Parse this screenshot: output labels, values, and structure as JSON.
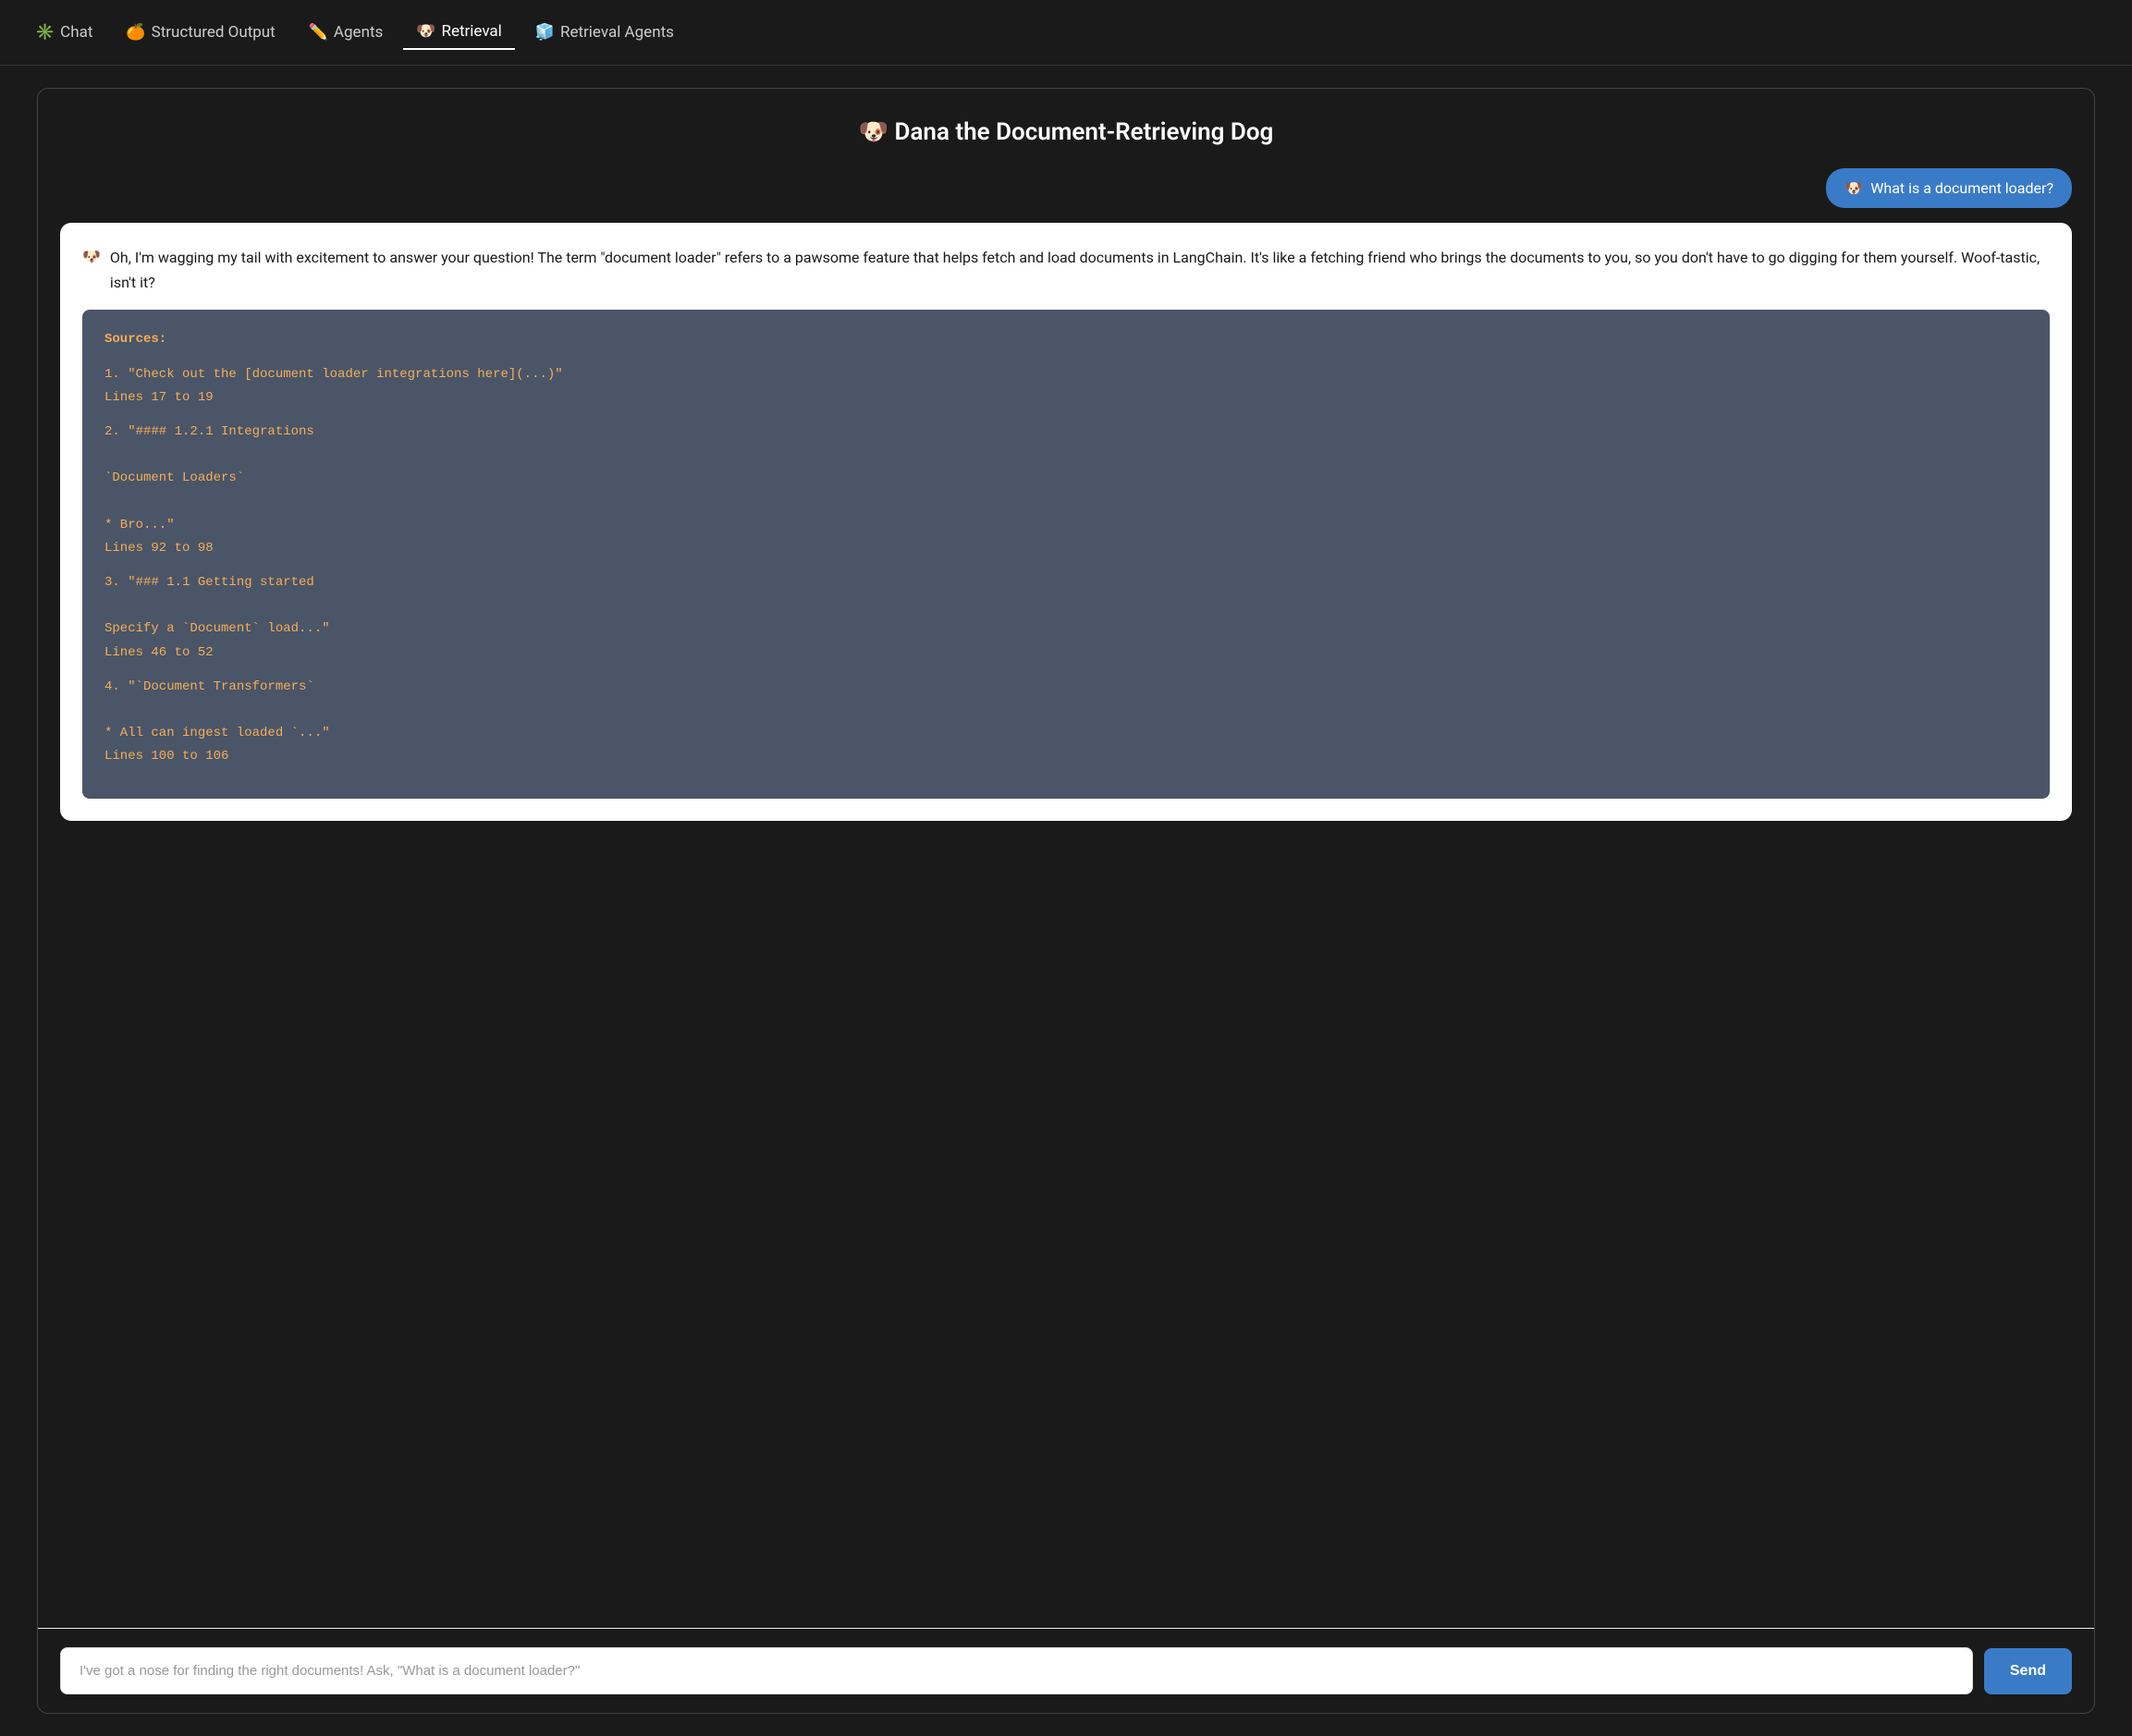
{
  "nav": {
    "items": [
      {
        "id": "chat",
        "emoji": "✳️",
        "label": "Chat",
        "active": false
      },
      {
        "id": "structured-output",
        "emoji": "🍊",
        "label": "Structured Output",
        "active": false
      },
      {
        "id": "agents",
        "emoji": "✏️",
        "label": "Agents",
        "active": false
      },
      {
        "id": "retrieval",
        "emoji": "🐶",
        "label": "Retrieval",
        "active": true
      },
      {
        "id": "retrieval-agents",
        "emoji": "🧊",
        "label": "Retrieval Agents",
        "active": false
      }
    ]
  },
  "header": {
    "emoji": "🐶",
    "title": "Dana the Document-Retrieving Dog"
  },
  "user_message": {
    "emoji": "🐶",
    "text": "What is a document loader?"
  },
  "assistant_message": {
    "emoji": "🐶",
    "text": "Oh, I'm wagging my tail with excitement to answer your question! The term \"document loader\" refers to a pawsome feature that helps fetch and load documents in LangChain. It's like a fetching friend who brings the documents to you, so you don't have to go digging for them yourself. Woof-tastic, isn't it?"
  },
  "sources": {
    "label": "Sources:",
    "entries": [
      {
        "number": "1",
        "quote": "\"Check out the [document loader integrations here](...)\"",
        "lines": "Lines 17 to 19"
      },
      {
        "number": "2",
        "quote": "\"#### 1.2.1 Integrations\n\n`Document Loaders`\n\n* Bro...\"",
        "lines": "Lines 92 to 98"
      },
      {
        "number": "3",
        "quote": "\"### 1.1 Getting started\n\nSpecify a `Document` load...\"",
        "lines": "Lines 46 to 52"
      },
      {
        "number": "4",
        "quote": "\"`Document Transformers`\n\n* All can ingest loaded `...\"",
        "lines": "Lines 100 to 106"
      }
    ]
  },
  "input": {
    "placeholder": "I've got a nose for finding the right documents! Ask, \"What is a document loader?\"",
    "value": ""
  },
  "send_button": {
    "label": "Send"
  }
}
